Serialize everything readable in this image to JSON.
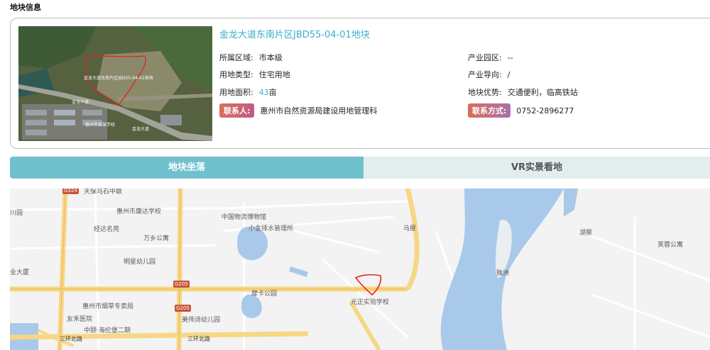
{
  "section_title": "地块信息",
  "plot": {
    "title": "金龙大道东南片区JBD55-04-01地块",
    "fields": {
      "region_label": "所属区域:",
      "region_value": "市本级",
      "land_use_label": "用地类型:",
      "land_use_value": "住宅用地",
      "area_label": "用地面积:",
      "area_value": "43",
      "area_unit": "亩",
      "park_label": "产业园区:",
      "park_value": "--",
      "industry_label": "产业导向:",
      "industry_value": "/",
      "advantage_label": "地块优势:",
      "advantage_value": "交通便利，临高铁站"
    },
    "contact_tag": "联系人:",
    "contact_value": "惠州市自然资源局建设用地管理科",
    "phone_tag": "联系方式:",
    "phone_value": "0752-2896277",
    "thumb_labels": {
      "plot_code": "金龙大道东南片区JBD55-04-01地块",
      "road_1": "金龙大道",
      "road_2": "金龙大道",
      "building": "惠州市某某学校"
    }
  },
  "tabs": {
    "location": "地块坐落",
    "vr": "VR实景看地"
  },
  "map": {
    "pois": {
      "kindergarten_top": "天保马石中联",
      "school_kangda": "惠州市康达学校",
      "logistics": "中国物流博物馆",
      "park_left": "川园",
      "jingda": "经达名苑",
      "wanxiang": "万乡公寓",
      "drainage": "小金排水管理所",
      "maxia": "马屋",
      "hulou": "湖屋",
      "furong": "芙蓉公寓",
      "mingxing": "明星幼儿园",
      "dasha": "业大厦",
      "duzhou": "独洲",
      "moka_park": "摩卡公园",
      "guangzheng": "光正实验学校",
      "tobacco": "惠州市烟草专卖局",
      "youhe": "友禾医院",
      "meiwei": "美伟诗幼儿园",
      "zhongdu": "中颐·海伦堡二期",
      "ring_road_1": "三环北路",
      "ring_road_2": "三环北路"
    },
    "shields": {
      "g324": "G324",
      "g205_a": "G205",
      "g205_b": "G205"
    }
  },
  "colors": {
    "accent": "#3aaecd",
    "tab_active": "#71c0ce",
    "tab_inactive": "#e2eded",
    "boundary": "#e8231c"
  }
}
